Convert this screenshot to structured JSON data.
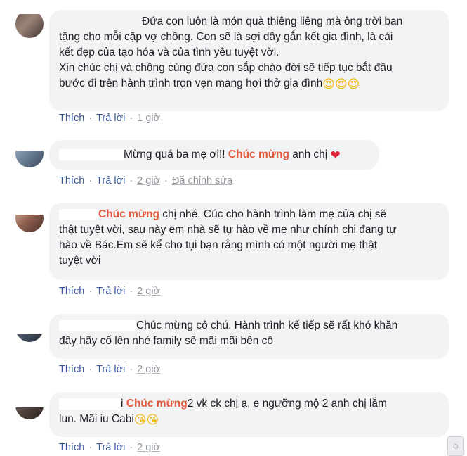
{
  "actions": {
    "like": "Thích",
    "reply": "Trả lời",
    "edited": "Đã chỉnh sửa"
  },
  "comments": [
    {
      "lines": [
        "Đứa con luôn là món quà thiêng liêng mà ông trời ban",
        "tặng cho mỗi cặp vợ chồng. Con sẽ là sợi dây gắn kết gia đình, là cái",
        "kết đẹp của tạo hóa và của tình yêu tuyệt vời.",
        "Xin chúc chị và chồng cùng đứa con sắp chào đời sẽ tiếp tục bắt đầu",
        "bước đi trên hành trình trọn vẹn mang hơi thở gia đình"
      ],
      "emoji": "😍😍😍",
      "time": "1 giờ"
    },
    {
      "pre": "Mừng quá ba mẹ ơi!! ",
      "highlight": "Chúc mừng",
      "post": " anh chị ",
      "emoji": "❤",
      "time": "2 giờ"
    },
    {
      "highlight": "Chúc mừng",
      "post": " chị nhé. Cúc cho hành trình làm mẹ của chị sẽ",
      "lines": [
        "thật tuyệt vời, sau này em nhà sẽ tự hào về mẹ như chính chị đang tự",
        "hào về Bác.Em sẽ kể cho tụi bạn rằng mình có một người mẹ thật",
        "tuyệt vời"
      ],
      "time": "2 giờ"
    },
    {
      "first": "Chúc mừng cô chú. Hành trình kế tiếp sẽ rất khó khăn",
      "lines": [
        "đây hãy cố lên nhé family sẽ mãi mãi bên cô"
      ],
      "time": "2 giờ"
    },
    {
      "pre": "i ",
      "highlight": "Chúc mừng",
      "post": "2 vk ck chị ạ, e ngưỡng mộ 2 anh chị lắm",
      "line2": "lun. Mãi iu Cabi",
      "emoji": "😘😘",
      "time": "2 giờ"
    }
  ],
  "colors": {
    "bubble": "#f2f3f5",
    "link": "#385898",
    "highlight": "#e25b3f",
    "meta": "#90949c"
  }
}
